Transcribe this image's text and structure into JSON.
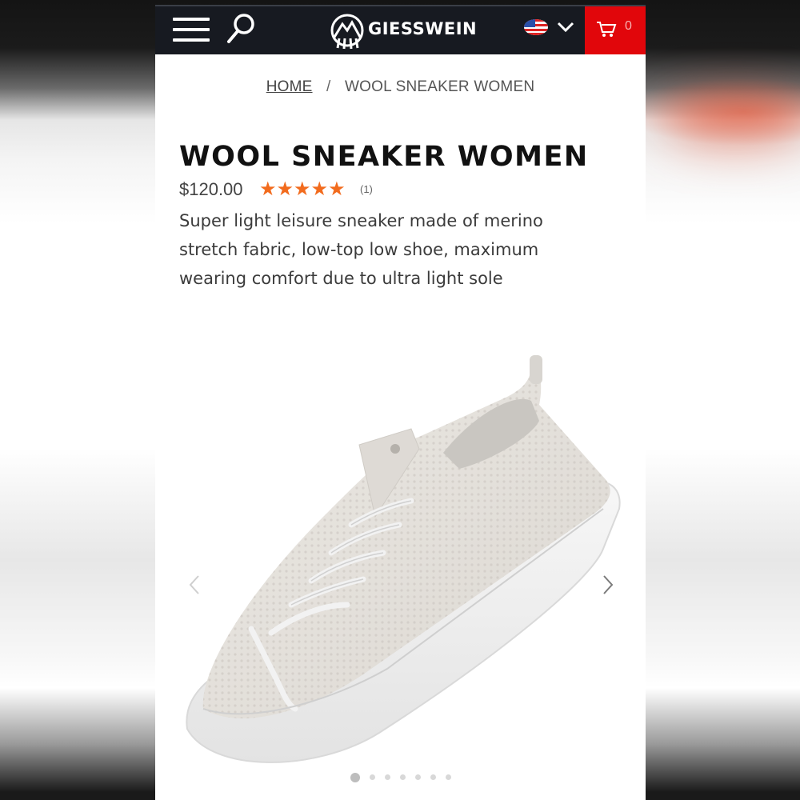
{
  "header": {
    "brand": "GIESSWEIN",
    "cart_count": "0",
    "menu_icon": "hamburger-icon",
    "search_icon": "search-icon",
    "locale_icon": "us-flag-icon",
    "cart_icon": "cart-icon",
    "cart_color": "#e1060b",
    "bar_color": "#171a21"
  },
  "breadcrumb": {
    "home": "HOME",
    "separator": "/",
    "current": "WOOL SNEAKER WOMEN"
  },
  "product": {
    "title": "WOOL SNEAKER WOMEN",
    "price": "$120.00",
    "rating": 5,
    "rating_max": 5,
    "star_color": "#f26b1d",
    "review_count": "(1)",
    "description": "Super light leisure sneaker made of merino stretch fabric, low-top low shoe, maximum wearing comfort due to ultra light sole"
  },
  "gallery": {
    "image": "white-wool-sneaker-product-photo",
    "total_slides": 7,
    "active_slide": 1
  }
}
